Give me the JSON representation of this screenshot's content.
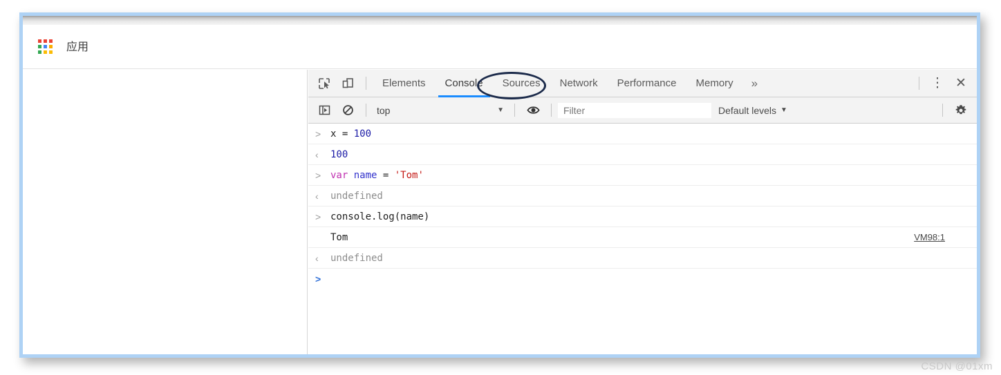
{
  "browser": {
    "bookmark_bar": {
      "apps_icon": "apps-grid-icon",
      "apps_label": "应用",
      "grid_colors": [
        "#ea4335",
        "#ea4335",
        "#ea4335",
        "#34a853",
        "#4285f4",
        "#fbac00",
        "#34a853",
        "#fbbc05",
        "#fbbc05"
      ]
    }
  },
  "devtools": {
    "toolbar": {
      "inspect_icon": "inspect-element-icon",
      "device_icon": "device-toolbar-icon",
      "more_tabs": "»",
      "menu_icon": "⋮",
      "close_icon": "✕"
    },
    "tabs": [
      {
        "label": "Elements",
        "active": false
      },
      {
        "label": "Console",
        "active": true
      },
      {
        "label": "Sources",
        "active": false
      },
      {
        "label": "Network",
        "active": false
      },
      {
        "label": "Performance",
        "active": false
      },
      {
        "label": "Memory",
        "active": false
      }
    ],
    "active_tab_accent": "#1a8cff",
    "annotation": {
      "shape": "ellipse",
      "target": "Console",
      "color": "#1b2a4a"
    },
    "filterbar": {
      "sidebar_icon": "console-sidebar-icon",
      "clear_icon": "clear-console-icon",
      "context": "top",
      "context_caret": "▼",
      "eye_icon": "live-expression-eye-icon",
      "filter_value": "",
      "filter_placeholder": "Filter",
      "levels": "Default levels",
      "levels_caret": "▼",
      "settings_icon": "settings-gear-icon"
    },
    "console_rows": [
      {
        "gutter": ">",
        "gutter_kind": "input",
        "tokens": [
          {
            "text": "x ",
            "cls": "tok-plain"
          },
          {
            "text": "= ",
            "cls": "tok-plain"
          },
          {
            "text": "100",
            "cls": "tok-num"
          }
        ],
        "source": ""
      },
      {
        "gutter": "‹",
        "gutter_kind": "output",
        "tokens": [
          {
            "text": "100",
            "cls": "tok-num"
          }
        ],
        "source": ""
      },
      {
        "gutter": ">",
        "gutter_kind": "input",
        "tokens": [
          {
            "text": "var ",
            "cls": "tok-kw"
          },
          {
            "text": "name ",
            "cls": "tok-var"
          },
          {
            "text": "= ",
            "cls": "tok-plain"
          },
          {
            "text": "'Tom'",
            "cls": "tok-str"
          }
        ],
        "source": ""
      },
      {
        "gutter": "‹",
        "gutter_kind": "output",
        "tokens": [
          {
            "text": "undefined",
            "cls": "tok-muted"
          }
        ],
        "source": ""
      },
      {
        "gutter": ">",
        "gutter_kind": "input",
        "tokens": [
          {
            "text": "console.log(name)",
            "cls": "tok-plain"
          }
        ],
        "source": ""
      },
      {
        "gutter": "",
        "gutter_kind": "log",
        "tokens": [
          {
            "text": "Tom",
            "cls": "tok-plain"
          }
        ],
        "source": "VM98:1"
      },
      {
        "gutter": "‹",
        "gutter_kind": "output",
        "tokens": [
          {
            "text": "undefined",
            "cls": "tok-muted"
          }
        ],
        "source": ""
      },
      {
        "gutter": ">",
        "gutter_kind": "prompt",
        "tokens": [],
        "source": ""
      }
    ]
  },
  "watermark": "CSDN @01xm"
}
